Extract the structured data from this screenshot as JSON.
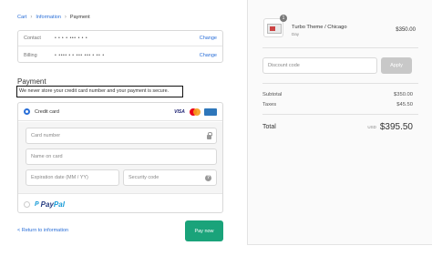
{
  "breadcrumb": {
    "cart": "Cart",
    "information": "Information",
    "payment": "Payment"
  },
  "review": {
    "contact_label": "Contact",
    "contact_value": "• • • • ••• • • •",
    "billing_label": "Billing",
    "billing_value": "• •••• • • ••• ••• • •• •",
    "change_label": "Change"
  },
  "payment": {
    "title": "Payment",
    "subtitle": "We never store your credit card number and your payment is secure.",
    "credit_card_label": "Credit card",
    "card_brand_visa": "VISA",
    "card_number_placeholder": "Card number",
    "name_placeholder": "Name on card",
    "expiry_placeholder": "Expiration date (MM / YY)",
    "security_placeholder": "Security code",
    "paypal_pay": "Pay",
    "paypal_pal": "Pal",
    "paypal_icon": "P"
  },
  "footer": {
    "return_link": "< Return to information",
    "pay_button": "Pay now"
  },
  "summary": {
    "item_name": "Turbo Theme / Chicago",
    "item_variant": "Day",
    "item_qty": "1",
    "item_price": "$350.00",
    "discount_placeholder": "Discount code",
    "apply_label": "Apply",
    "subtotal_label": "Subtotal",
    "subtotal_value": "$350.00",
    "taxes_label": "Taxes",
    "taxes_value": "$45.50",
    "total_label": "Total",
    "total_currency": "USD",
    "total_value": "$395.50"
  },
  "colors": {
    "accent": "#2a6fd8",
    "pay_button": "#1aa37a",
    "apply_button_disabled": "#c8c8c8"
  },
  "icons": [
    "chevron-right-icon",
    "lock-icon",
    "help-icon",
    "visa-icon",
    "mastercard-icon",
    "amex-icon",
    "paypal-icon",
    "product-thumbnail"
  ]
}
